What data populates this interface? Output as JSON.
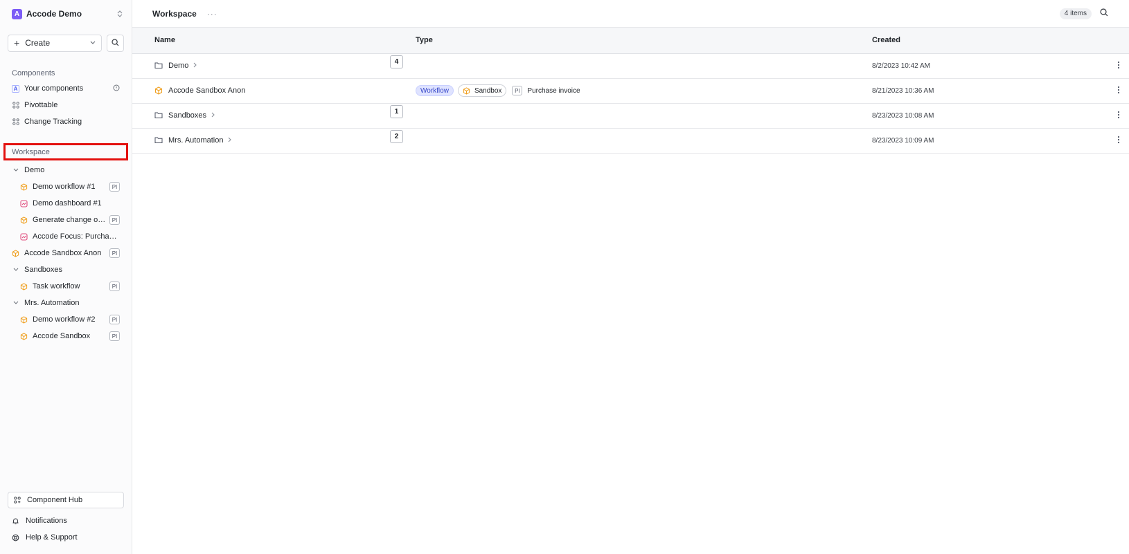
{
  "org": {
    "initial": "A",
    "name": "Accode Demo"
  },
  "sidebar": {
    "create_label": "Create",
    "components_title": "Components",
    "components": [
      {
        "label": "Your components"
      },
      {
        "label": "Pivottable"
      },
      {
        "label": "Change Tracking"
      }
    ],
    "workspace_title": "Workspace",
    "tree": {
      "demo": {
        "label": "Demo"
      },
      "demo_workflow_1": {
        "label": "Demo workflow #1",
        "badge": "PI"
      },
      "demo_dashboard_1": {
        "label": "Demo dashboard #1"
      },
      "generate_change": {
        "label": "Generate change oper...",
        "badge": "PI"
      },
      "accode_focus": {
        "label": "Accode Focus: Purchase in..."
      },
      "accode_sandbox_anon": {
        "label": "Accode Sandbox Anon",
        "badge": "PI"
      },
      "sandboxes": {
        "label": "Sandboxes"
      },
      "task_workflow": {
        "label": "Task workflow",
        "badge": "PI"
      },
      "mrs_automation": {
        "label": "Mrs. Automation"
      },
      "demo_workflow_2": {
        "label": "Demo workflow #2",
        "badge": "PI"
      },
      "accode_sandbox": {
        "label": "Accode Sandbox",
        "badge": "PI"
      }
    },
    "bottom": {
      "hub": "Component Hub",
      "notifications": "Notifications",
      "help": "Help & Support"
    }
  },
  "header": {
    "title": "Workspace",
    "more": "···",
    "count": "4 items"
  },
  "table": {
    "columns": {
      "name": "Name",
      "type": "Type",
      "created": "Created"
    },
    "rows": [
      {
        "name": "Demo",
        "count": "4",
        "created": "8/2/2023 10:42 AM"
      },
      {
        "name": "Accode Sandbox Anon",
        "type_pill": "Workflow",
        "sandbox": "Sandbox",
        "badge": "PI",
        "doc": "Purchase invoice",
        "created": "8/21/2023 10:36 AM"
      },
      {
        "name": "Sandboxes",
        "count": "1",
        "created": "8/23/2023 10:08 AM"
      },
      {
        "name": "Mrs. Automation",
        "count": "2",
        "created": "8/23/2023 10:09 AM"
      }
    ]
  },
  "colors": {
    "accent_purple": "#7c5cf6",
    "workflow_orange": "#f0a020",
    "dashboard_pink": "#e04b7c",
    "highlight_red": "#e3100e",
    "workflow_pill_bg": "#dfe3ff"
  },
  "icons": [
    "chevron-updown-icon",
    "plus-icon",
    "chevron-down-icon",
    "search-icon",
    "grid-icon",
    "info-icon",
    "cube-icon",
    "dashboard-icon",
    "folder-icon",
    "chevron-right-icon",
    "kebab-icon",
    "bell-icon",
    "lifebuoy-icon"
  ]
}
